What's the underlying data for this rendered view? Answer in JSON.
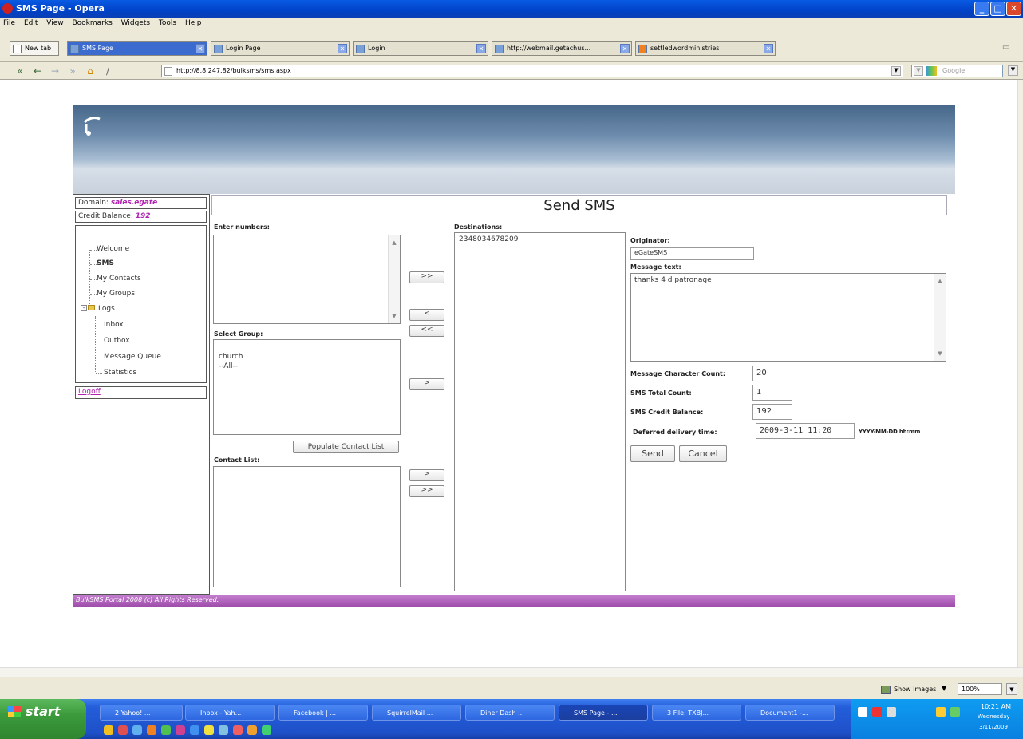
{
  "window": {
    "title": "SMS Page - Opera"
  },
  "menu": [
    "File",
    "Edit",
    "View",
    "Bookmarks",
    "Widgets",
    "Tools",
    "Help"
  ],
  "tabs": [
    {
      "label": "New tab"
    },
    {
      "label": "SMS Page"
    },
    {
      "label": "Login Page"
    },
    {
      "label": "Login"
    },
    {
      "label": "http://webmail.getachus..."
    },
    {
      "label": "settledwordministries"
    }
  ],
  "address": {
    "url": "http://8.8.247.82/bulksms/sms.aspx",
    "search_placeholder": "Google"
  },
  "sidebar": {
    "domain_label": "Domain: ",
    "domain_value": "sales.egate",
    "credit_label": "Credit Balance: ",
    "credit_value": "192",
    "items": [
      "Welcome",
      "SMS",
      "My Contacts",
      "My Groups",
      "Logs",
      "Inbox",
      "Outbox",
      "Message Queue",
      "Statistics"
    ],
    "logoff": "Logoff"
  },
  "main": {
    "title": "Send SMS",
    "enter_numbers_label": "Enter numbers:",
    "select_group_label": "Select Group:",
    "groups": [
      "church",
      "--All--"
    ],
    "populate_button": "Populate Contact List",
    "contact_list_label": "Contact List:",
    "destinations_label": "Destinations:",
    "destinations": [
      "2348034678209"
    ],
    "btn_add_all": ">>",
    "btn_remove": "<",
    "btn_remove_all": "<<",
    "btn_add_group": ">",
    "btn_add_contact": ">",
    "btn_add_contacts_all": ">>",
    "originator_label": "Originator:",
    "originator_value": "eGateSMS",
    "message_label": "Message text:",
    "message_value": "thanks 4 d patronage",
    "char_count_label": "Message Character Count:",
    "char_count_value": "20",
    "total_count_label": "SMS Total Count:",
    "total_count_value": "1",
    "credit_balance_label": "SMS Credit Balance:",
    "credit_balance_value": "192",
    "deferred_label": "Deferred delivery time:",
    "deferred_value": "2009-3-11 11:20",
    "deferred_format": "YYYY-MM-DD hh:mm",
    "send_button": "Send",
    "cancel_button": "Cancel"
  },
  "footer": {
    "text": "BulkSMS Portal 2008 (c) All Rights Reserved."
  },
  "statusbar": {
    "show_images": "Show Images",
    "zoom": "100%"
  },
  "taskbar": {
    "start": "start",
    "buttons": [
      "2 Yahoo! ...",
      "Inbox - Yah...",
      "Facebook | ...",
      "SquirrelMail ...",
      "Diner Dash ...",
      "SMS Page - ...",
      "3 File: TXBJ...",
      "Document1 -..."
    ],
    "clock": "10:21 AM",
    "day": "Wednesday",
    "date": "3/11/2009"
  },
  "colors": {
    "accent_purple": "#b022b0",
    "header_blue": "#47678a",
    "footer_purple": "#9c4aa8"
  }
}
